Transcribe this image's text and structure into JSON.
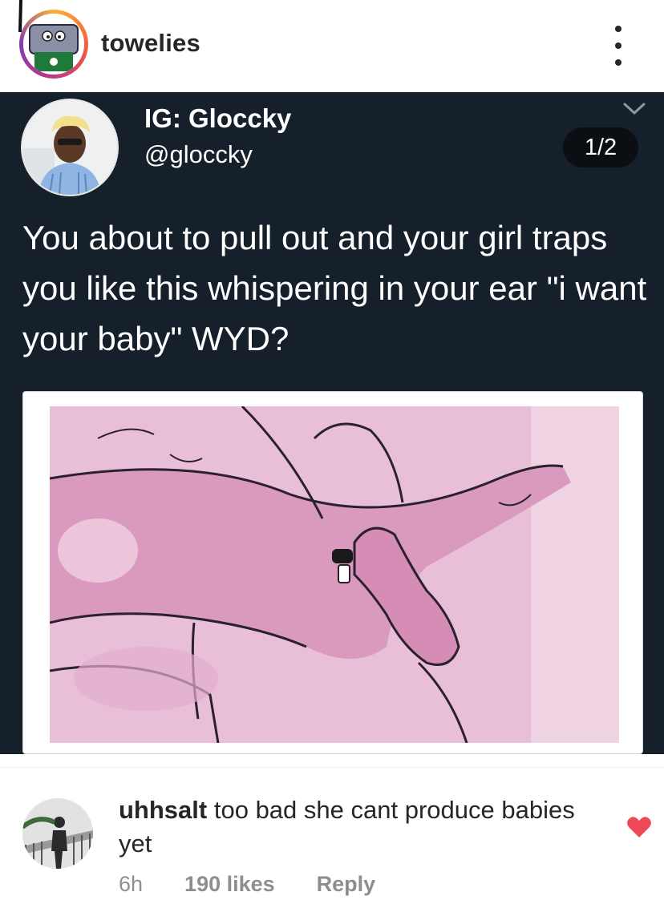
{
  "post": {
    "username": "towelies",
    "more_icon": "more-vertical-icon"
  },
  "tweet": {
    "display_name": "IG: Gloccky",
    "handle": "@gloccky",
    "pager": "1/2",
    "text": "You about to pull out and your girl traps you like this whispering in your ear \"i want your baby\" WYD?",
    "media": "cartoon-illustration",
    "colors": {
      "background": "#15202b",
      "media_pink": "#e6b8d2"
    }
  },
  "comment": {
    "username": "uhhsalt",
    "text": "too bad she cant produce babies yet",
    "time": "6h",
    "likes": "190 likes",
    "reply": "Reply",
    "heart_color": "#ed4956"
  }
}
